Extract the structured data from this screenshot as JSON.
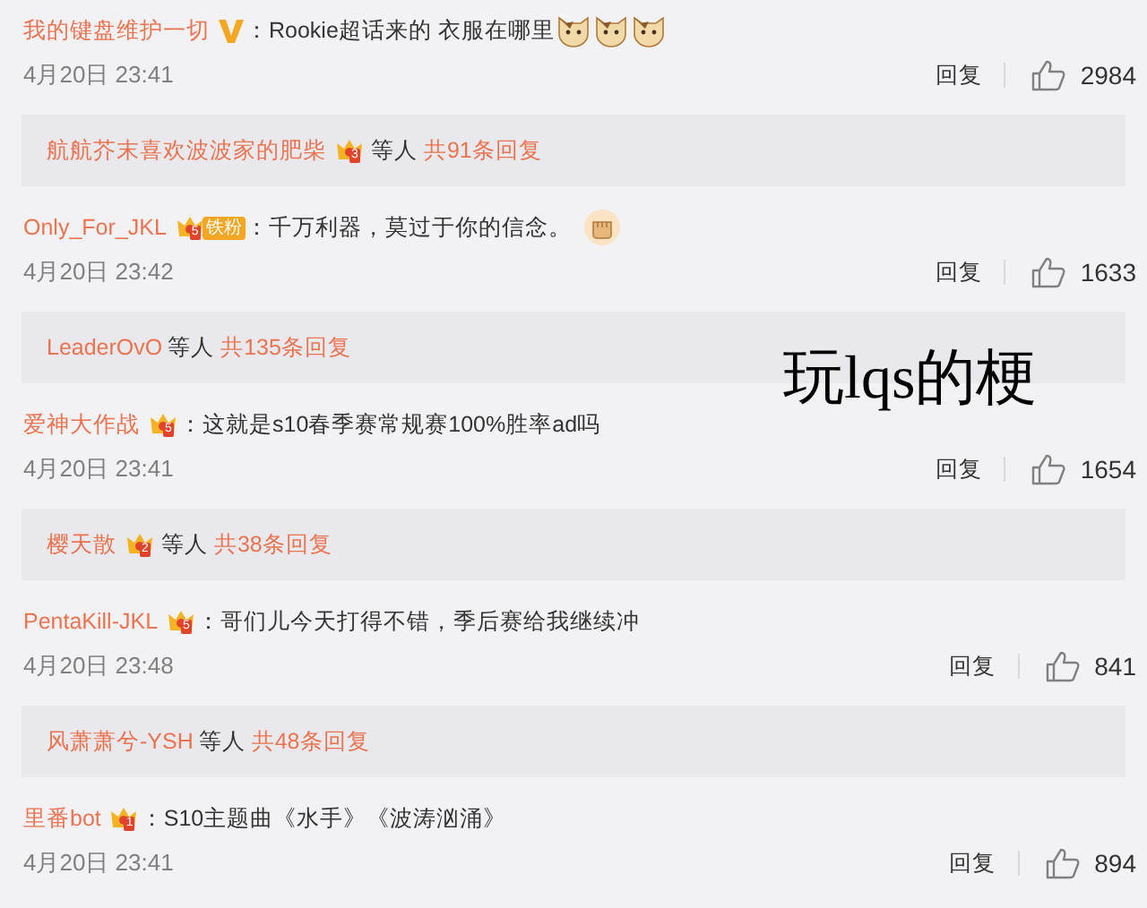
{
  "items": [
    {
      "kind": "comment",
      "user": "我的键盘维护一切",
      "badges": [
        {
          "kind": "verified"
        }
      ],
      "colon": "：",
      "text": "Rookie超话来的 衣服在哪里",
      "emoji": [
        {
          "kind": "cat"
        },
        {
          "kind": "cat"
        },
        {
          "kind": "cat"
        }
      ],
      "time": "4月20日 23:41",
      "reply": "回复",
      "likes": "2984"
    },
    {
      "kind": "replies",
      "user": "航航芥末喜欢波波家的肥柴",
      "badges": [
        {
          "kind": "crown",
          "level": "3"
        }
      ],
      "suffix": "等人",
      "count": "共91条回复"
    },
    {
      "kind": "comment",
      "user": "Only_For_JKL",
      "badges": [
        {
          "kind": "crown",
          "level": "5",
          "tag": "铁粉"
        }
      ],
      "colon": "：",
      "text": "千万利器，莫过于你的信念。",
      "emoji": [
        {
          "kind": "fist"
        }
      ],
      "time": "4月20日 23:42",
      "reply": "回复",
      "likes": "1633"
    },
    {
      "kind": "replies",
      "user": "LeaderOvO",
      "suffix": "等人",
      "count": "共135条回复"
    },
    {
      "kind": "comment",
      "user": "爱神大作战",
      "badges": [
        {
          "kind": "crown",
          "level": "5"
        }
      ],
      "colon": "：",
      "text": "这就是s10春季赛常规赛100%胜率ad吗",
      "time": "4月20日 23:41",
      "reply": "回复",
      "likes": "1654"
    },
    {
      "kind": "replies",
      "user": "樱天散",
      "badges": [
        {
          "kind": "crown",
          "level": "2"
        }
      ],
      "suffix": "等人",
      "count": "共38条回复"
    },
    {
      "kind": "comment",
      "user": "PentaKill-JKL",
      "badges": [
        {
          "kind": "crown",
          "level": "5"
        }
      ],
      "colon": "：",
      "text": "哥们儿今天打得不错，季后赛给我继续冲",
      "time": "4月20日 23:48",
      "reply": "回复",
      "likes": "841"
    },
    {
      "kind": "replies",
      "user": "风萧萧兮-YSH",
      "suffix": "等人",
      "count": "共48条回复"
    },
    {
      "kind": "comment",
      "user": "里番bot",
      "badges": [
        {
          "kind": "crown",
          "level": "1"
        }
      ],
      "colon": "：",
      "text": "S10主题曲《水手》《波涛汹涌》",
      "time": "4月20日 23:41",
      "reply": "回复",
      "likes": "894"
    }
  ],
  "overlay_caption": "玩lqs的梗"
}
